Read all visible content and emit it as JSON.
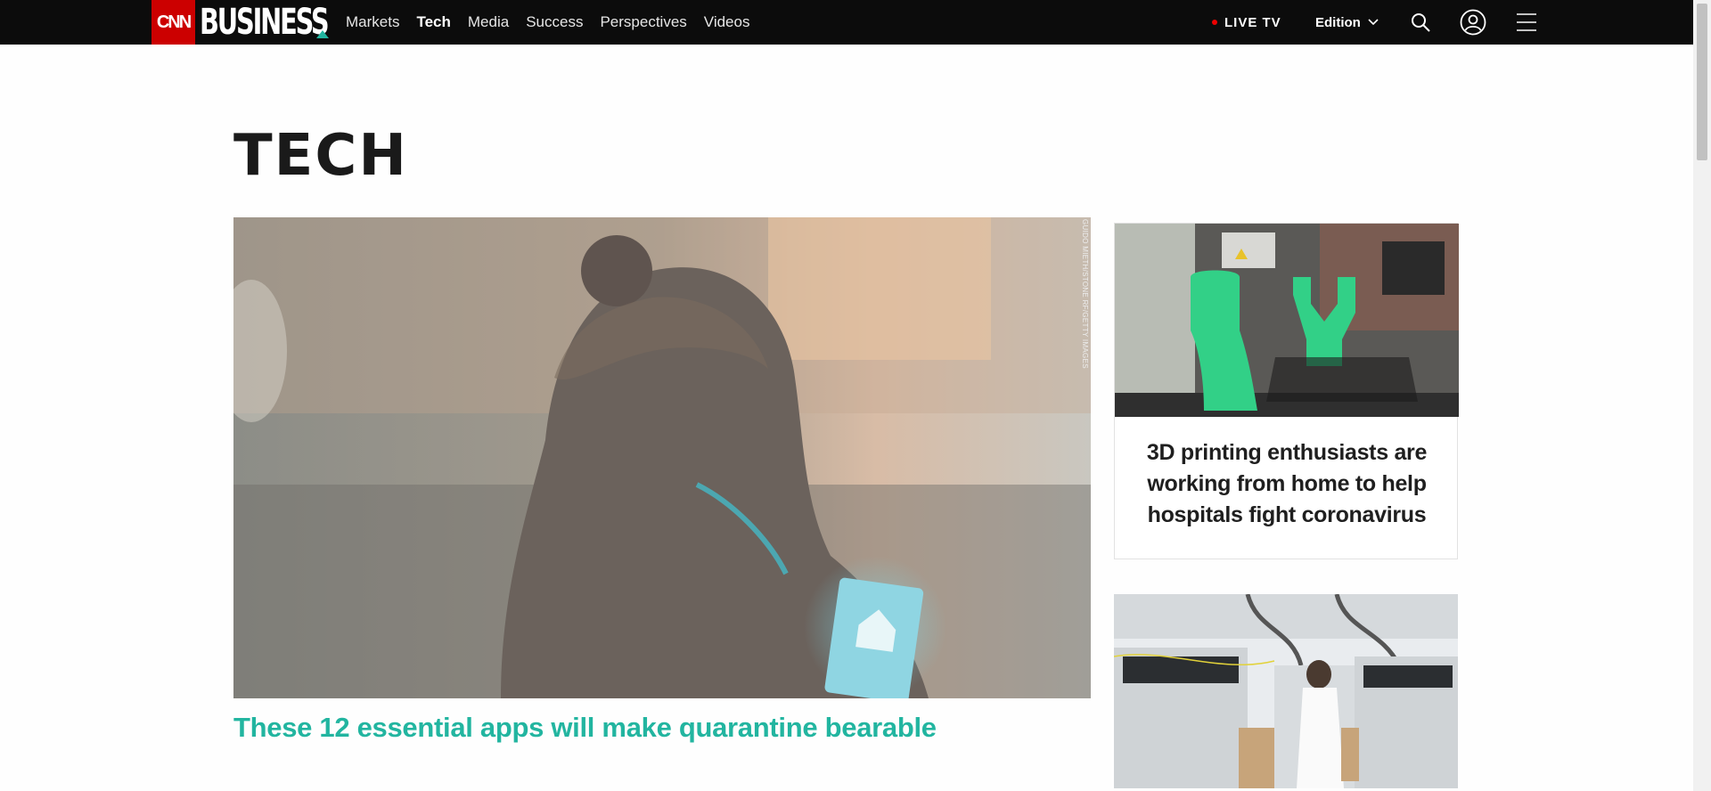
{
  "brand": {
    "cnn": "CNN",
    "business": "BUSINESS"
  },
  "nav": {
    "items": [
      {
        "label": "Markets"
      },
      {
        "label": "Tech"
      },
      {
        "label": "Media"
      },
      {
        "label": "Success"
      },
      {
        "label": "Perspectives"
      },
      {
        "label": "Videos"
      }
    ],
    "live_tv": "LIVE TV",
    "edition": "Edition"
  },
  "page": {
    "title": "TECH"
  },
  "hero": {
    "headline": "These 12 essential apps will make quarantine bearable",
    "credit": "GUIDO MIETH/STONE RF/GETTY IMAGES"
  },
  "side": [
    {
      "headline": "3D printing enthusiasts are working from home to help hospitals fight coronavirus"
    }
  ],
  "colors": {
    "accent": "#22b5a0",
    "brand_red": "#cc0000",
    "nav_bg": "#0c0c0c"
  }
}
